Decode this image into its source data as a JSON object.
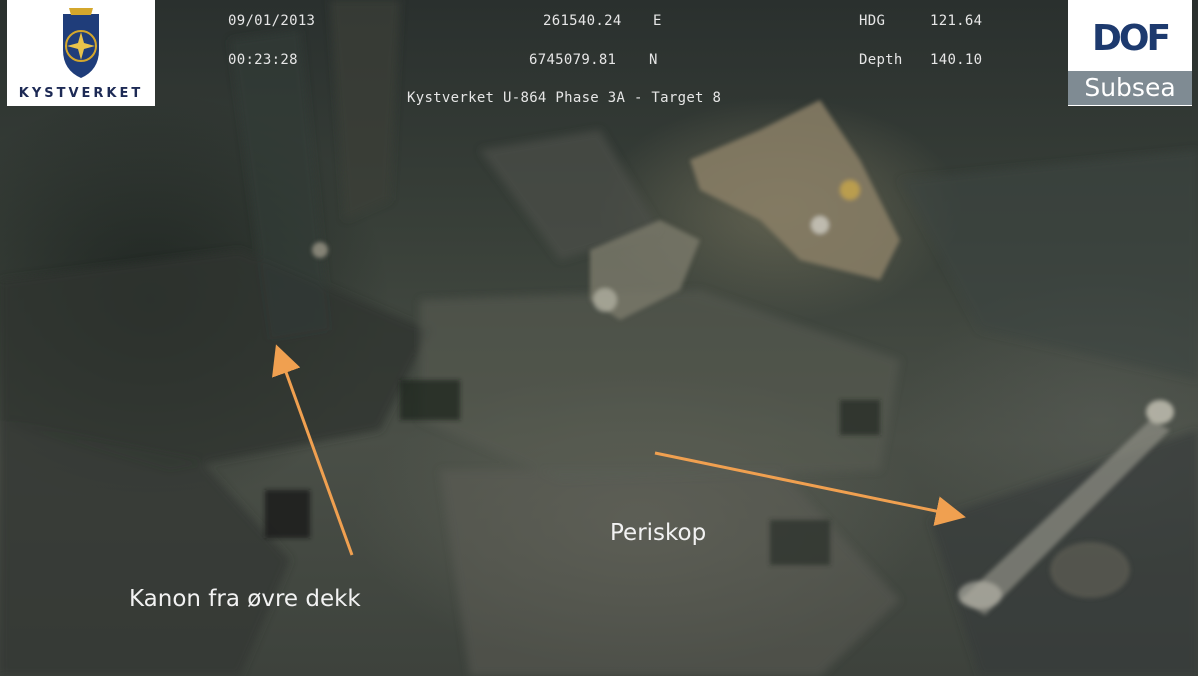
{
  "overlay": {
    "date": "09/01/2013",
    "time": "00:23:28",
    "easting_value": "261540.24",
    "easting_dir": "E",
    "northing_value": "6745079.81",
    "northing_dir": "N",
    "hdg_label": "HDG",
    "hdg_value": "121.64",
    "depth_label": "Depth",
    "depth_value": "140.10",
    "mission": "Kystverket U-864 Phase 3A - Target 8"
  },
  "logos": {
    "left_wordmark": "KYSTVERKET",
    "right_wordmark": "DOF",
    "right_subtitle": "Subsea"
  },
  "annotations": {
    "gun_label": "Kanon fra øvre dekk",
    "periscope_label": "Periskop",
    "arrow_color": "#f0a050"
  }
}
